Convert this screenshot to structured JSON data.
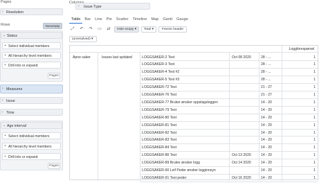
{
  "left": {
    "pages_label": "Pages",
    "resolution_label": "Resolution",
    "rows_label": "Rows",
    "nonempty_label": "Nonempty",
    "status_label": "Status",
    "status_options": [
      "Select individual members",
      "All hierarchy level members",
      "Drill into or expand"
    ],
    "pages_button": "Pages",
    "measures_label": "Measures",
    "issue_label": "Issue",
    "time_label": "Time",
    "age_label": "Age interval",
    "age_options": [
      "Select individual members",
      "All hierarchy level members",
      "Drill into or expand"
    ]
  },
  "main": {
    "columns_label": "Columns",
    "issue_type_label": "Issue Type",
    "tabs": [
      "Table",
      "Bar",
      "Line",
      "Pie",
      "Scatter",
      "Timeline",
      "Map",
      "Gantt",
      "Gauge"
    ],
    "toolbar": {
      "hide_empty": "Hide empty",
      "total": "Total",
      "freeze_header": "Freeze header"
    },
    "filter_value": "(unresolved)",
    "table": {
      "col_header": "Loggforespørsel",
      "status": "Åpne saker",
      "measure": "Issues last updated",
      "rows": [
        {
          "issue": "LOGGSAKER-2 Test",
          "date": "Oct 08 2020",
          "age": "28 - ...",
          "val": "1"
        },
        {
          "issue": "LOGGSAKER-3 Test",
          "date": "",
          "age": "28 - ...",
          "val": "1"
        },
        {
          "issue": "LOGGSAKER-4 Test #2",
          "date": "",
          "age": "28 - ...",
          "val": "1"
        },
        {
          "issue": "LOGGSAKER-5 Test #3",
          "date": "",
          "age": "28 - ...",
          "val": "1"
        },
        {
          "issue": "LOGGSAKER-72 Test",
          "date": "",
          "age": "21 - 27",
          "val": "1"
        },
        {
          "issue": "LOGGSAKER-76 Test",
          "date": "",
          "age": "21 - 27",
          "val": "1"
        },
        {
          "issue": "LOGGSAKER-77 Bruker ønsker oppslagsloggen",
          "date": "",
          "age": "14 - 20",
          "val": "1"
        },
        {
          "issue": "LOGGSAKER-79 Test",
          "date": "",
          "age": "14 - 20",
          "val": "1"
        },
        {
          "issue": "LOGGSAKER-80 Test",
          "date": "",
          "age": "14 - 20",
          "val": "1"
        },
        {
          "issue": "LOGGSAKER-81 Test",
          "date": "",
          "age": "14 - 20",
          "val": "1"
        },
        {
          "issue": "LOGGSAKER-82 Test",
          "date": "",
          "age": "14 - 20",
          "val": "1"
        },
        {
          "issue": "LOGGSAKER-83 Test",
          "date": "",
          "age": "14 - 20",
          "val": "1"
        },
        {
          "issue": "LOGGSAKER-84 Test",
          "date": "",
          "age": "14 - 20",
          "val": "1"
        },
        {
          "issue": "LOGGSAKER-86 Test",
          "date": "Oct 13 2020",
          "age": "14 - 20",
          "val": "1"
        },
        {
          "issue": "LOGGSAKER-89 Bruker ønsker logg",
          "date": "Oct 14 2020",
          "age": "14 - 20",
          "val": "1"
        },
        {
          "issue": "LOGGSAKER-90 Leif Peder ønsker logginnsyn",
          "date": "",
          "age": "14 - 20",
          "val": "1"
        },
        {
          "issue": "LOGGSAKER-91 Test peder",
          "date": "Oct 16 2020",
          "age": "14 - 20",
          "val": "1"
        }
      ]
    }
  }
}
